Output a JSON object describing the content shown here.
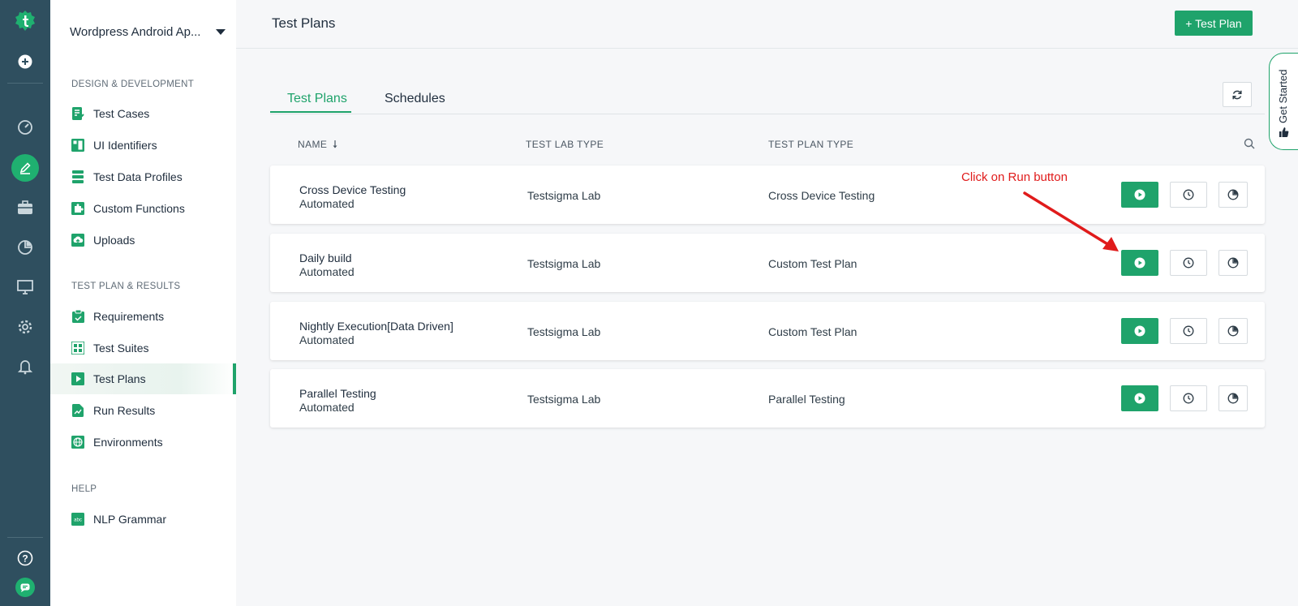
{
  "project": {
    "name": "Wordpress Android Ap..."
  },
  "sidebar": {
    "sections": [
      {
        "title": "DESIGN & DEVELOPMENT",
        "items": [
          {
            "label": "Test Cases",
            "icon": "test-cases-icon"
          },
          {
            "label": "UI Identifiers",
            "icon": "ui-identifiers-icon"
          },
          {
            "label": "Test Data Profiles",
            "icon": "test-data-icon"
          },
          {
            "label": "Custom Functions",
            "icon": "puzzle-icon"
          },
          {
            "label": "Uploads",
            "icon": "upload-icon"
          }
        ]
      },
      {
        "title": "TEST PLAN & RESULTS",
        "items": [
          {
            "label": "Requirements",
            "icon": "clipboard-icon"
          },
          {
            "label": "Test Suites",
            "icon": "test-suites-icon"
          },
          {
            "label": "Test Plans",
            "icon": "play-icon",
            "active": true
          },
          {
            "label": "Run Results",
            "icon": "run-results-icon"
          },
          {
            "label": "Environments",
            "icon": "globe-icon"
          }
        ]
      },
      {
        "title": "HELP",
        "items": [
          {
            "label": "NLP Grammar",
            "icon": "abc-icon"
          }
        ]
      }
    ]
  },
  "header": {
    "title": "Test Plans",
    "add_button": "+ Test Plan"
  },
  "tabs": [
    {
      "label": "Test Plans",
      "active": true
    },
    {
      "label": "Schedules",
      "active": false
    }
  ],
  "table": {
    "columns": [
      "NAME",
      "TEST LAB TYPE",
      "TEST PLAN TYPE"
    ],
    "rows": [
      {
        "name": "Cross Device Testing",
        "mode": "Automated",
        "lab": "Testsigma Lab",
        "type": "Cross Device Testing"
      },
      {
        "name": "Daily build",
        "mode": "Automated",
        "lab": "Testsigma Lab",
        "type": "Custom Test Plan"
      },
      {
        "name": "Nightly Execution[Data Driven]",
        "mode": "Automated",
        "lab": "Testsigma Lab",
        "type": "Custom Test Plan"
      },
      {
        "name": "Parallel Testing",
        "mode": "Automated",
        "lab": "Testsigma Lab",
        "type": "Parallel Testing"
      }
    ]
  },
  "annotation": {
    "text": "Click on Run button",
    "color": "#e01b1b"
  },
  "get_started": {
    "label": "Get Started"
  },
  "colors": {
    "accent": "#1fa36b",
    "rail": "#2f4f5f"
  }
}
